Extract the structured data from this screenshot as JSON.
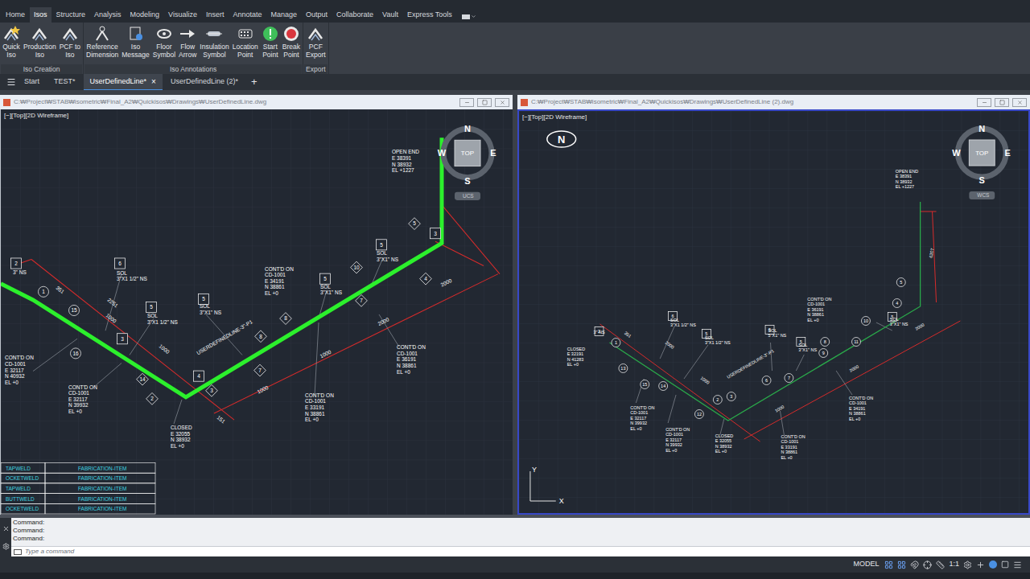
{
  "ribbon_tabs": [
    {
      "label": "Home",
      "selected": false
    },
    {
      "label": "Isos",
      "selected": true
    },
    {
      "label": "Structure",
      "selected": false
    },
    {
      "label": "Analysis",
      "selected": false
    },
    {
      "label": "Modeling",
      "selected": false
    },
    {
      "label": "Visualize",
      "selected": false
    },
    {
      "label": "Insert",
      "selected": false
    },
    {
      "label": "Annotate",
      "selected": false
    },
    {
      "label": "Manage",
      "selected": false
    },
    {
      "label": "Output",
      "selected": false
    },
    {
      "label": "Collaborate",
      "selected": false
    },
    {
      "label": "Vault",
      "selected": false
    },
    {
      "label": "Express Tools",
      "selected": false
    }
  ],
  "ribbon_groups": [
    {
      "label": "Iso Creation",
      "buttons": [
        {
          "lines": [
            "Quick",
            "Iso"
          ]
        },
        {
          "lines": [
            "Production",
            "Iso"
          ]
        },
        {
          "lines": [
            "PCF to",
            "Iso"
          ]
        }
      ]
    },
    {
      "label": "Iso Annotations",
      "buttons": [
        {
          "lines": [
            "Reference",
            "Dimension"
          ]
        },
        {
          "lines": [
            "Iso",
            "Message"
          ]
        },
        {
          "lines": [
            "Floor",
            "Symbol"
          ]
        },
        {
          "lines": [
            "Flow",
            "Arrow"
          ]
        },
        {
          "lines": [
            "Insulation",
            "Symbol"
          ]
        },
        {
          "lines": [
            "Location",
            "Point"
          ]
        },
        {
          "lines": [
            "Start",
            "Point"
          ]
        },
        {
          "lines": [
            "Break",
            "Point"
          ]
        }
      ]
    },
    {
      "label": "Export",
      "buttons": [
        {
          "lines": [
            "PCF",
            "Export"
          ]
        }
      ]
    }
  ],
  "file_tabs": [
    {
      "label": "Start",
      "selected": false
    },
    {
      "label": "TEST*",
      "selected": false
    },
    {
      "label": "UserDefinedLine*",
      "selected": true
    },
    {
      "label": "UserDefinedLine (2)*",
      "selected": false
    }
  ],
  "file_tab_close": "×",
  "file_tab_new": "+",
  "viewports": [
    {
      "path": "C:₩Project₩STAB₩isometric₩Final_A2₩Quickisos₩Drawings₩UserDefinedLine.dwg",
      "view_label": "[−][Top][2D Wireframe]",
      "active": false,
      "compass": {
        "n": "N",
        "e": "E",
        "s": "S",
        "w": "W",
        "top": "TOP",
        "ucs": "UCS"
      },
      "line_name": "USERDEFINEDLINE-3\"-P1",
      "labels": [
        {
          "lines": [
            "OPEN END",
            "E 38391",
            "N 38932",
            "EL +1227"
          ]
        },
        {
          "lines": [
            "3\" NS"
          ]
        },
        {
          "lines": [
            "SOL",
            "3\"X1 1/2\" NS"
          ]
        },
        {
          "lines": [
            "SOL",
            "3\"X1 1/2\" NS"
          ]
        },
        {
          "lines": [
            "SOL",
            "3\"X1\" NS"
          ]
        },
        {
          "lines": [
            "CONT'D ON",
            "CD-1001",
            "E 34191",
            "N 38861",
            "EL +0"
          ]
        },
        {
          "lines": [
            "SOL",
            "3\"X1\" NS"
          ]
        },
        {
          "lines": [
            "SOL",
            "3\"X1\" NS"
          ]
        },
        {
          "lines": [
            "CONT'D ON",
            "CD-1001",
            "E 32117",
            "N 40932",
            "EL +0"
          ]
        },
        {
          "lines": [
            "CONT'D ON",
            "CD-1001",
            "E 32117",
            "N 39932",
            "EL +0"
          ]
        },
        {
          "lines": [
            "CONT'D ON",
            "CD-1001",
            "E 33191",
            "N 38861",
            "EL +0"
          ]
        },
        {
          "lines": [
            "CONT'D ON",
            "CD-1001",
            "E 36191",
            "N 38861",
            "EL +0"
          ]
        },
        {
          "lines": [
            "CLOSED",
            "E 32055",
            "N 38932",
            "EL +0"
          ]
        }
      ],
      "markers": [
        {
          "text": "2",
          "kind": "box"
        },
        {
          "text": "6",
          "kind": "box"
        },
        {
          "text": "5",
          "kind": "box"
        },
        {
          "text": "5",
          "kind": "box"
        },
        {
          "text": "5",
          "kind": "box"
        },
        {
          "text": "5",
          "kind": "box"
        },
        {
          "text": "1",
          "kind": "circle"
        },
        {
          "text": "15",
          "kind": "circle"
        },
        {
          "text": "16",
          "kind": "circle"
        },
        {
          "text": "3",
          "kind": "box"
        },
        {
          "text": "14",
          "kind": "diamond"
        },
        {
          "text": "2",
          "kind": "diamond"
        },
        {
          "text": "4",
          "kind": "box"
        },
        {
          "text": "3",
          "kind": "diamond"
        },
        {
          "text": "8",
          "kind": "diamond"
        },
        {
          "text": "7",
          "kind": "diamond"
        },
        {
          "text": "8",
          "kind": "diamond"
        },
        {
          "text": "10",
          "kind": "diamond"
        },
        {
          "text": "7",
          "kind": "diamond"
        },
        {
          "text": "4",
          "kind": "diamond"
        },
        {
          "text": "5",
          "kind": "diamond"
        },
        {
          "text": "3",
          "kind": "box"
        }
      ],
      "dimensions": [
        "351",
        "2251",
        "1000",
        "1000",
        "2000",
        "2000",
        "1000",
        "1000",
        "151"
      ],
      "weld_table": [
        {
          "type": "TAPWELD",
          "item": "FABRICATION-ITEM"
        },
        {
          "type": "OCKETWELD",
          "item": "FABRICATION-ITEM"
        },
        {
          "type": "TAPWELD",
          "item": "FABRICATION-ITEM"
        },
        {
          "type": "BUTTWELD",
          "item": "FABRICATION-ITEM"
        },
        {
          "type": "OCKETWELD",
          "item": "FABRICATION-ITEM"
        }
      ]
    },
    {
      "path": "C:₩Project₩STAB₩isometric₩Final_A2₩Quickisos₩Drawings₩UserDefinedLine (2).dwg",
      "view_label": "[−][Top][2D Wireframe]",
      "active": true,
      "compass": {
        "n": "N",
        "e": "E",
        "s": "S",
        "w": "W",
        "top": "TOP",
        "ucs": "WCS"
      },
      "line_name": "USERDEFINEDLINE-3\"-P1",
      "north_badge": "N",
      "axes": {
        "x": "X",
        "y": "Y"
      },
      "labels": [
        {
          "lines": [
            "OPEN END",
            "E 38391",
            "N 38932",
            "EL +1227"
          ]
        },
        {
          "lines": [
            "3\" NS"
          ]
        },
        {
          "lines": [
            "SOL",
            "3\"X1 1/2\" NS"
          ]
        },
        {
          "lines": [
            "SOL",
            "3\"X1 1/2\" NS"
          ]
        },
        {
          "lines": [
            "SOL",
            "5\"X1\" NS"
          ]
        },
        {
          "lines": [
            "SOL",
            "3\"X1\" NS"
          ]
        },
        {
          "lines": [
            "SOL",
            "3\"X1\" NS"
          ]
        },
        {
          "lines": [
            "CLOSED",
            "E 32191",
            "N 41283",
            "EL +0"
          ]
        },
        {
          "lines": [
            "CONT'D ON",
            "CD-1001",
            "E 32117",
            "N 39932",
            "EL +0"
          ]
        },
        {
          "lines": [
            "CONT'D ON",
            "CD-1001",
            "E 32117",
            "N 39932",
            "EL +0"
          ]
        },
        {
          "lines": [
            "CONT'D ON",
            "CD-1001",
            "E 36191",
            "N 38861",
            "EL +0"
          ]
        },
        {
          "lines": [
            "CONT'D ON",
            "CD-1001",
            "E 34191",
            "N 38861",
            "EL +0"
          ]
        },
        {
          "lines": [
            "CLOSED",
            "E 32055",
            "N 38932",
            "EL +0"
          ]
        },
        {
          "lines": [
            "CONT'D ON",
            "CD-1001",
            "E 33191",
            "N 38861",
            "EL +0"
          ]
        }
      ],
      "markers": [
        {
          "text": "2",
          "kind": "box"
        },
        {
          "text": "6",
          "kind": "box"
        },
        {
          "text": "5",
          "kind": "box"
        },
        {
          "text": "5",
          "kind": "box"
        },
        {
          "text": "5",
          "kind": "box"
        },
        {
          "text": "5",
          "kind": "box"
        },
        {
          "text": "1",
          "kind": "circle"
        },
        {
          "text": "13",
          "kind": "circle"
        },
        {
          "text": "15",
          "kind": "circle"
        },
        {
          "text": "14",
          "kind": "circle"
        },
        {
          "text": "3",
          "kind": "circle"
        },
        {
          "text": "2",
          "kind": "circle"
        },
        {
          "text": "12",
          "kind": "circle"
        },
        {
          "text": "6",
          "kind": "circle"
        },
        {
          "text": "7",
          "kind": "circle"
        },
        {
          "text": "8",
          "kind": "circle"
        },
        {
          "text": "9",
          "kind": "circle"
        },
        {
          "text": "10",
          "kind": "circle"
        },
        {
          "text": "11",
          "kind": "circle"
        },
        {
          "text": "4",
          "kind": "circle"
        },
        {
          "text": "5",
          "kind": "circle"
        }
      ],
      "dimensions": [
        "351",
        "2000",
        "1000",
        "1000",
        "2000",
        "2000",
        "6207"
      ],
      "weld_table": []
    }
  ],
  "command": {
    "history": [
      "Command:",
      "Command:",
      "Command:"
    ],
    "placeholder": "Type a command"
  },
  "status_bar": {
    "model": "MODEL",
    "scale": "1:1"
  }
}
